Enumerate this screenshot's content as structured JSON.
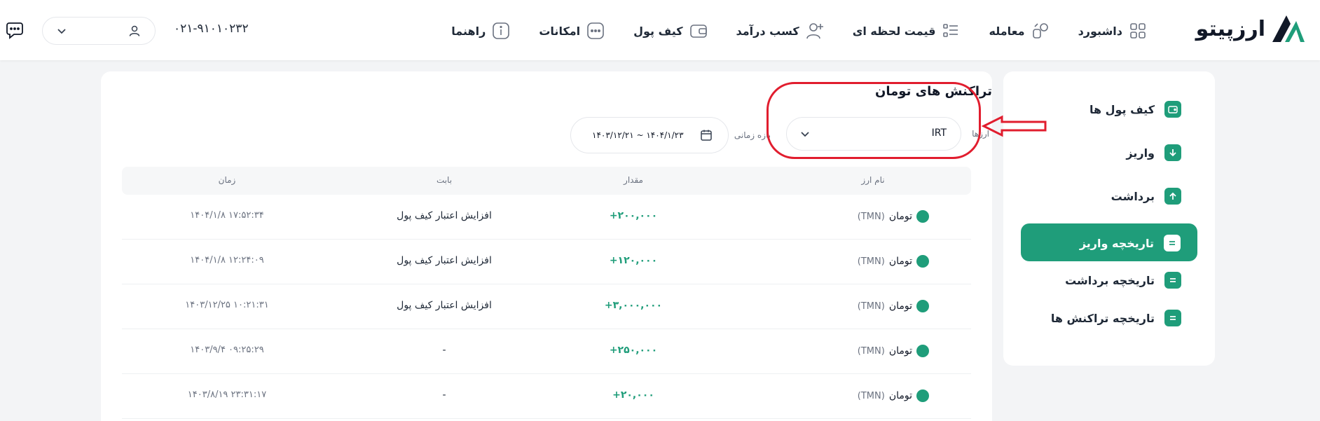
{
  "brand": {
    "name": "ارزپیتو",
    "color": "#1f9d7a"
  },
  "nav": [
    {
      "label": "داشبورد",
      "icon": "grid-icon"
    },
    {
      "label": "معامله",
      "icon": "exchange-icon"
    },
    {
      "label": "قیمت لحظه ای",
      "icon": "price-list-icon"
    },
    {
      "label": "کسب درآمد",
      "icon": "add-user-icon"
    },
    {
      "label": "کیف پول",
      "icon": "wallet-icon"
    },
    {
      "label": "امکانات",
      "icon": "more-icon"
    },
    {
      "label": "راهنما",
      "icon": "info-icon"
    }
  ],
  "header": {
    "phone": "۰۲۱-۹۱۰۱۰۲۳۲"
  },
  "sidebar": {
    "items": [
      {
        "label": "کیف پول ها",
        "icon": "wallet-icon",
        "active": false
      },
      {
        "label": "واریز",
        "icon": "arrow-down-icon",
        "active": false
      },
      {
        "label": "برداشت",
        "icon": "arrow-up-icon",
        "active": false
      },
      {
        "label": "تاریخچه واریز",
        "icon": "list-icon",
        "active": true
      },
      {
        "label": "تاریخچه برداشت",
        "icon": "list-icon",
        "active": false
      },
      {
        "label": "تاریخچه تراکنش ها",
        "icon": "list-icon",
        "active": false
      }
    ]
  },
  "main": {
    "title": "تراکنش های تومان",
    "currency_label": "ارزها",
    "currency_value": "IRT",
    "date_label": "بازه زمانی",
    "date_value": "۱۴۰۳/۱۲/۲۱ ~ ۱۴۰۴/۱/۲۳"
  },
  "table": {
    "columns": [
      "نام ارز",
      "مقدار",
      "بابت",
      "زمان"
    ],
    "rows": [
      {
        "coin": "تومان",
        "code": "(TMN)",
        "amount": "+۲۰۰,۰۰۰",
        "reason": "افزایش اعتبار کیف پول",
        "time": "۱۴۰۴/۱/۸ ۱۷:۵۲:۳۴"
      },
      {
        "coin": "تومان",
        "code": "(TMN)",
        "amount": "+۱۲۰,۰۰۰",
        "reason": "افزایش اعتبار کیف پول",
        "time": "۱۴۰۴/۱/۸ ۱۲:۲۴:۰۹"
      },
      {
        "coin": "تومان",
        "code": "(TMN)",
        "amount": "+۳,۰۰۰,۰۰۰",
        "reason": "افزایش اعتبار کیف پول",
        "time": "۱۴۰۳/۱۲/۲۵ ۱۰:۲۱:۳۱"
      },
      {
        "coin": "تومان",
        "code": "(TMN)",
        "amount": "+۲۵۰,۰۰۰",
        "reason": "-",
        "time": "۱۴۰۳/۹/۴ ۰۹:۲۵:۲۹"
      },
      {
        "coin": "تومان",
        "code": "(TMN)",
        "amount": "+۲۰,۰۰۰",
        "reason": "-",
        "time": "۱۴۰۳/۸/۱۹ ۲۳:۳۱:۱۷"
      }
    ]
  }
}
